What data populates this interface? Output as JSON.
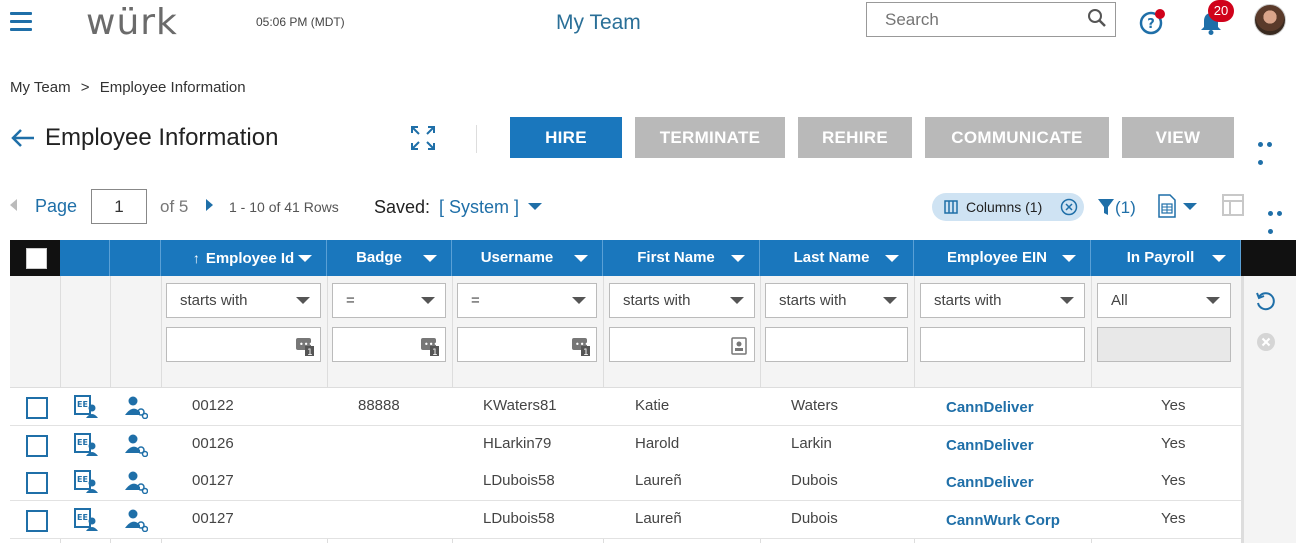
{
  "header": {
    "logo": "würk",
    "clock": "05:06 PM (MDT)",
    "app_title": "My Team",
    "search_placeholder": "Search",
    "notification_count": "20",
    "colors": {
      "accent": "#1a77bd",
      "badge": "#d0021b",
      "disabled": "#b9b9b9"
    }
  },
  "breadcrumb": {
    "items": [
      "My Team",
      ">",
      "Employee Information"
    ]
  },
  "page": {
    "title": "Employee Information"
  },
  "actions": {
    "hire": "HIRE",
    "terminate": "TERMINATE",
    "rehire": "REHIRE",
    "communicate": "COMMUNICATE",
    "view": "VIEW"
  },
  "pager": {
    "label": "Page",
    "current": "1",
    "of_text": "of 5",
    "rows_text": "1 - 10 of 41 Rows",
    "saved_label": "Saved:",
    "saved_value": "[ System ]"
  },
  "toolbar": {
    "columns_chip": "Columns (1)",
    "filter_count": "(1)"
  },
  "grid": {
    "columns": {
      "employee_id": "Employee Id",
      "badge": "Badge",
      "username": "Username",
      "first_name": "First Name",
      "last_name": "Last Name",
      "employee_ein": "Employee EIN",
      "in_payroll": "In Payroll"
    },
    "filters": {
      "employee_id": "starts with",
      "badge": "=",
      "username": "=",
      "first_name": "starts with",
      "last_name": "starts with",
      "employee_ein": "starts with",
      "in_payroll": "All"
    },
    "rows": [
      {
        "employee_id": "00122",
        "badge": "88888",
        "username": "KWaters81",
        "first_name": "Katie",
        "last_name": "Waters",
        "employee_ein": "CannDeliver",
        "in_payroll": "Yes"
      },
      {
        "employee_id": "00126",
        "badge": "",
        "username": "HLarkin79",
        "first_name": "Harold",
        "last_name": "Larkin",
        "employee_ein": "CannDeliver",
        "in_payroll": "Yes"
      },
      {
        "employee_id": "00127",
        "badge": "",
        "username": "LDubois58",
        "first_name": "Laureñ",
        "last_name": "Dubois",
        "employee_ein": "CannDeliver",
        "in_payroll": "Yes"
      },
      {
        "employee_id": "00127",
        "badge": "",
        "username": "LDubois58",
        "first_name": "Laureñ",
        "last_name": "Dubois",
        "employee_ein": "CannWurk Corp",
        "in_payroll": "Yes"
      }
    ]
  }
}
